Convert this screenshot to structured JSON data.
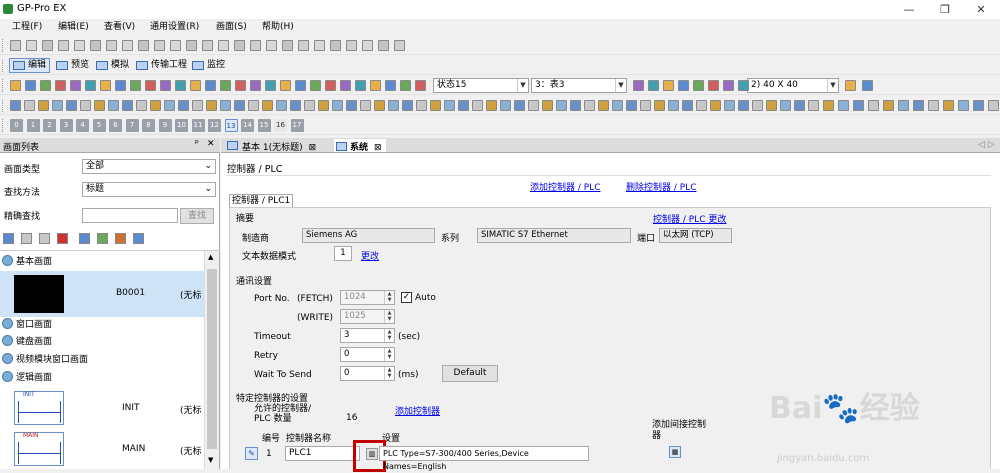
{
  "window": {
    "title": "GP-Pro EX",
    "controls": [
      "—",
      "❐",
      "✕"
    ]
  },
  "menu": [
    "工程(F)",
    "编辑(E)",
    "查看(V)",
    "通用设置(R)",
    "画面(S)",
    "帮助(H)"
  ],
  "modes": [
    {
      "label": "编辑",
      "active": true
    },
    {
      "label": "预览",
      "active": false
    },
    {
      "label": "模拟",
      "active": false
    },
    {
      "label": "传输工程",
      "active": false
    },
    {
      "label": "监控",
      "active": false
    }
  ],
  "toolbar": {
    "state_combo": "状态15",
    "table_combo": "3：表3",
    "size_combo": "2) 40 X 40"
  },
  "number_row": [
    "0",
    "1",
    "2",
    "3",
    "4",
    "5",
    "6",
    "7",
    "8",
    "9",
    "10",
    "11",
    "12",
    "13",
    "14",
    "15",
    "16",
    "17"
  ],
  "screen_list": {
    "title": "画面列表",
    "pin": "ᵖ",
    "close": "✕",
    "type_label": "画面类型",
    "type_value": "全部",
    "search_label": "查找方法",
    "search_value": "标题",
    "exact_label": "精确查找",
    "exact_btn": "查找",
    "groups": {
      "base": "基本画面",
      "window": "窗口画面",
      "keypad": "键盘画面",
      "video": "视频模块窗口画面",
      "logic": "逻辑画面"
    },
    "base_item": {
      "id": "B0001",
      "title": "(无标"
    },
    "logic_items": [
      {
        "id": "INIT",
        "title": "(无标"
      },
      {
        "id": "MAIN",
        "title": "(无标"
      }
    ],
    "init_thumb": "INIT",
    "main_thumb": "MAIN"
  },
  "tabs": [
    {
      "label": "基本 1(无标题)",
      "close": "⊠"
    },
    {
      "label": "系统",
      "close": "⊠"
    }
  ],
  "nav": "◁ ▷",
  "plc": {
    "breadcrumb": "控制器 / PLC",
    "add_link": "添加控制器 / PLC",
    "del_link": "删除控制器 / PLC",
    "tab": "控制器 / PLC1",
    "summary": "摘要",
    "change_link": "控制器 / PLC 更改",
    "maker_label": "制造商",
    "maker": "Siemens AG",
    "series_label": "系列",
    "series": "SIMATIC S7 Ethernet",
    "port_label": "端口",
    "port": "以太网 (TCP)",
    "textmode_label": "文本数据模式",
    "textmode": "1",
    "textmode_change": "更改",
    "comm_title": "通讯设置",
    "port_no": "Port No.",
    "fetch": "(FETCH)",
    "fetch_val": "1024",
    "auto": "Auto",
    "write": "(WRITE)",
    "write_val": "1025",
    "timeout": "Timeout",
    "timeout_val": "3",
    "sec": "(sec)",
    "retry": "Retry",
    "retry_val": "0",
    "wait": "Wait To Send",
    "wait_val": "0",
    "ms": "(ms)",
    "default_btn": "Default",
    "specific_title": "特定控制器的设置",
    "allowed_label": "允许的控制器/ PLC 数量",
    "allowed_val": "16",
    "add_ctrl_link": "添加控制器",
    "col_no": "编号",
    "col_name": "控制器名称",
    "col_settings": "设置",
    "col_indirect": "添加间接控制器",
    "row": {
      "no": "1",
      "name": "PLC1",
      "settings": "PLC Type=S7-300/400 Series,Device Names=English"
    }
  },
  "watermark": {
    "logo": "Bai🐾经验",
    "url": "jingyan.baidu.com"
  }
}
